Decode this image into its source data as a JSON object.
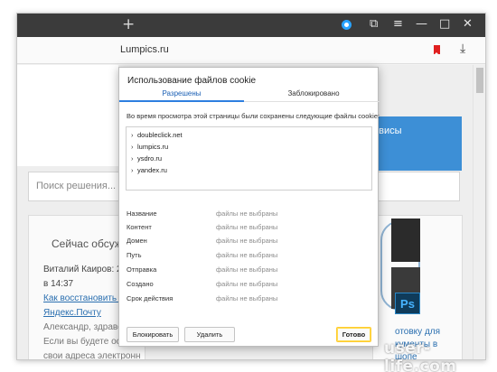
{
  "browser": {
    "new_tab_glyph": "+",
    "url": "Lumpics.ru",
    "controls": {
      "tabs_glyph": "⧉",
      "menu_glyph": "≡",
      "minimize_glyph": "—",
      "maximize_glyph": "□",
      "close_glyph": "✕",
      "download_glyph": "⤓"
    }
  },
  "page": {
    "search_placeholder": "Поиск решения...",
    "banner_text": "рвисы",
    "left_card": {
      "heading": "Сейчас обсуж",
      "author": "Виталий Каиров: 20",
      "time": "в 14:37",
      "link1": "Как восстановить удал",
      "link2": "Яндекс.Почту",
      "line1": "Александр, здравству",
      "line2": "Если вы будете остава",
      "line3": "свои адреса электронн"
    },
    "right_card": {
      "ps_label": "Ps",
      "line1": "отовку для",
      "line2": "кументы в",
      "line3": "шопе"
    }
  },
  "dialog": {
    "title": "Использование файлов cookie",
    "tabs": [
      {
        "label": "Разрешены",
        "active": true
      },
      {
        "label": "Заблокировано",
        "active": false
      }
    ],
    "intro": "Во время просмотра этой страницы были сохранены следующие файлы cookie:",
    "sites": [
      "doubleclick.net",
      "lumpics.ru",
      "ysdro.ru",
      "yandex.ru"
    ],
    "properties": [
      {
        "label": "Название",
        "value": "файлы не выбраны"
      },
      {
        "label": "Контент",
        "value": "файлы не выбраны"
      },
      {
        "label": "Домен",
        "value": "файлы не выбраны"
      },
      {
        "label": "Путь",
        "value": "файлы не выбраны"
      },
      {
        "label": "Отправка",
        "value": "файлы не выбраны"
      },
      {
        "label": "Создано",
        "value": "файлы не выбраны"
      },
      {
        "label": "Срок действия",
        "value": "файлы не выбраны"
      }
    ],
    "buttons": {
      "block": "Блокировать",
      "delete": "Удалить",
      "done": "Готово"
    }
  },
  "watermark": "user-life.com",
  "colors": {
    "accent_blue": "#2d7fe0",
    "bookmark_red": "#e02020",
    "done_border": "#ffcc33",
    "tabbar": "#3b3b3b"
  }
}
